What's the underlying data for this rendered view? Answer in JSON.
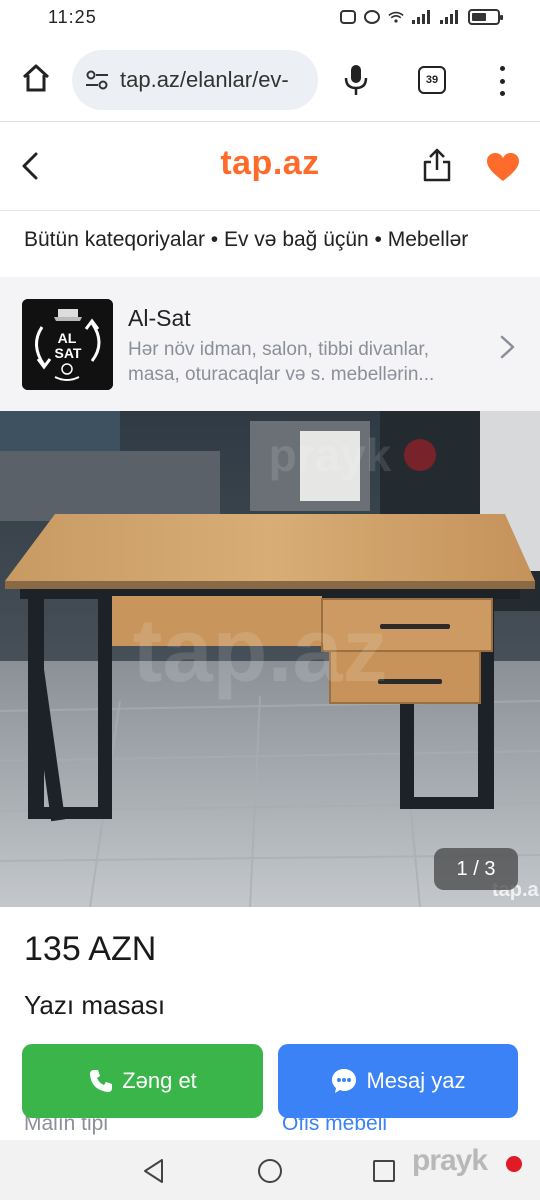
{
  "status_bar": {
    "time": "11:25"
  },
  "browser": {
    "url": "tap.az/elanlar/ev-",
    "tab_count": "39",
    "icons": [
      "home-icon",
      "site-settings-icon",
      "mic-icon",
      "tabs-icon",
      "more-vert-icon"
    ]
  },
  "header": {
    "logo": "tap.az",
    "logo_color": "#ff6b2b",
    "icons": [
      "back-icon",
      "share-icon",
      "heart-icon"
    ]
  },
  "breadcrumb": "Bütün kateqoriyalar • Ev və bağ üçün • Mebellər",
  "shop": {
    "name": "Al-Sat",
    "description": "Hər növ idman, salon, tibbi divanlar, masa, oturacaqlar və s. mebellərin...",
    "logo_line1": "AL",
    "logo_line2": "SAT"
  },
  "gallery": {
    "counter": "1 / 3",
    "watermark": "tap.az",
    "watermark2": "prayk",
    "corner_mark": "tap.a"
  },
  "listing": {
    "price": "135 AZN",
    "title": "Yazı masası"
  },
  "actions": {
    "call_label": "Zəng et",
    "message_label": "Mesaj yaz",
    "call_color": "#3ab54a",
    "message_color": "#3b82f6"
  },
  "properties": {
    "label": "Malın tipi",
    "value": "Ofis mebeli"
  },
  "nav": {
    "watermark": "prayk"
  }
}
